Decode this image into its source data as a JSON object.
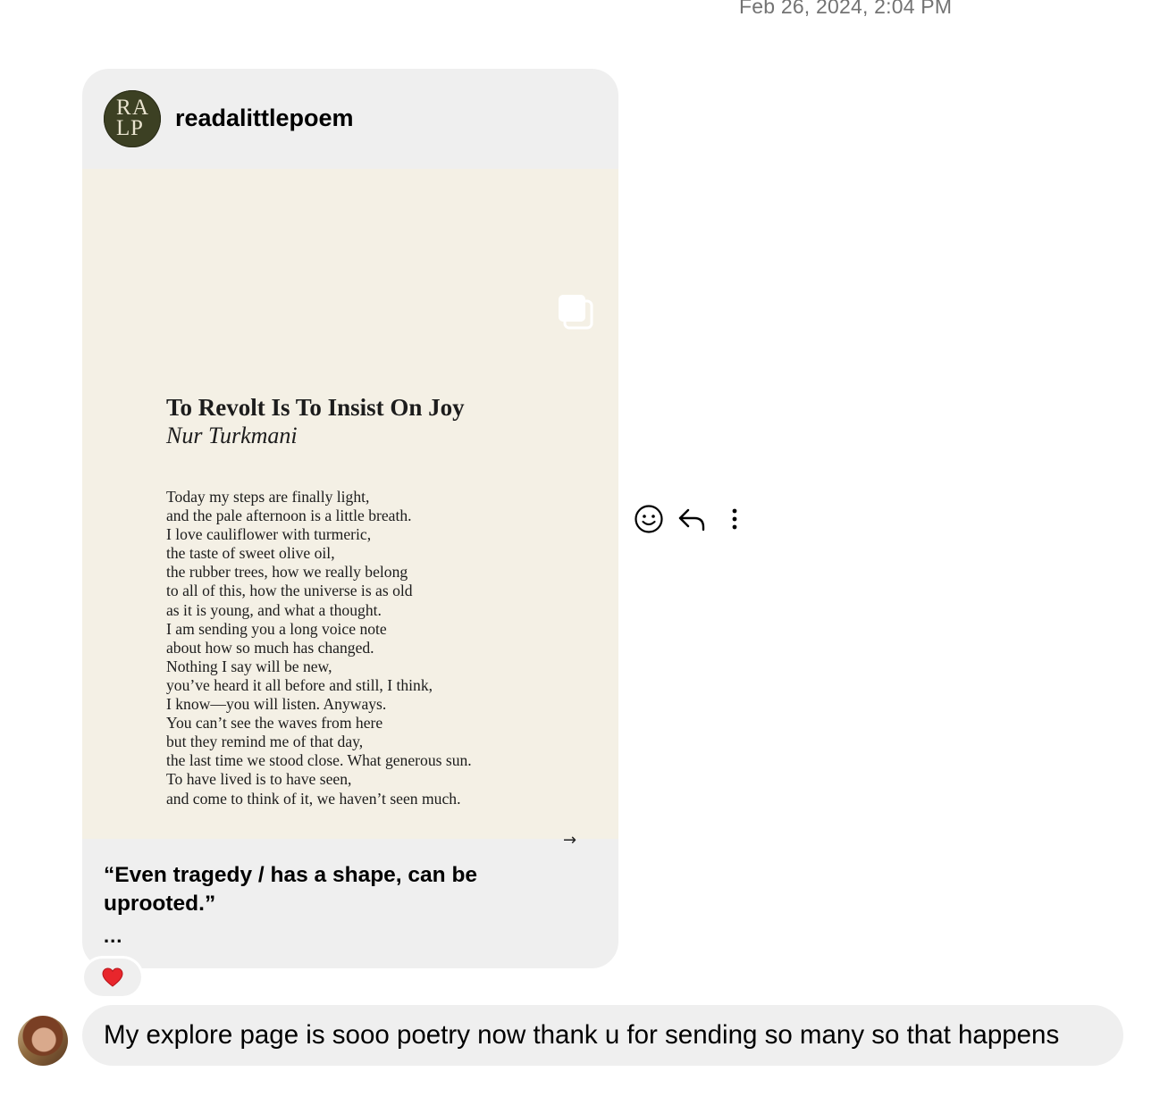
{
  "timestamp": "Feb 26, 2024, 2:04 PM",
  "shared_post": {
    "account_name": "readalittlepoem",
    "avatar_letters": [
      "R",
      "A",
      "L",
      "P"
    ],
    "poem": {
      "title": "To Revolt Is To Insist On Joy",
      "author": "Nur Turkmani",
      "lines": [
        "Today my steps are finally light,",
        "and the pale afternoon is a little breath.",
        "I love cauliflower with turmeric,",
        "the taste of sweet olive oil,",
        "the rubber trees, how we really belong",
        "to all of this, how the universe is as old",
        "as it is young, and what a thought.",
        "I am sending you a long voice note",
        "about how so much has changed.",
        "Nothing I say will be new,",
        "you’ve heard it all before and still, I think,",
        "I know—you will listen. Anyways.",
        "You can’t see the waves from here",
        "but they remind me of that day,",
        "the last time we stood close. What generous sun.",
        "To have lived is to have seen,",
        "and come to think of it, we haven’t seen much."
      ],
      "next_arrow": "→"
    },
    "caption": "“Even tragedy / has a shape, can be uprooted.”",
    "caption_more": "...",
    "icons": {
      "carousel": "carousel-icon",
      "reaction": "heart-icon"
    }
  },
  "actions": {
    "icons": [
      "emoji-icon",
      "reply-icon",
      "more-options-icon"
    ]
  },
  "message": {
    "text": "My explore page is sooo poetry now thank u for sending so many so that happens"
  },
  "colors": {
    "bubble": "#efefef",
    "post_background": "#f4f0e5",
    "avatar_green": "#3c4023",
    "heart": "#e8262c",
    "timestamp": "#737373"
  }
}
